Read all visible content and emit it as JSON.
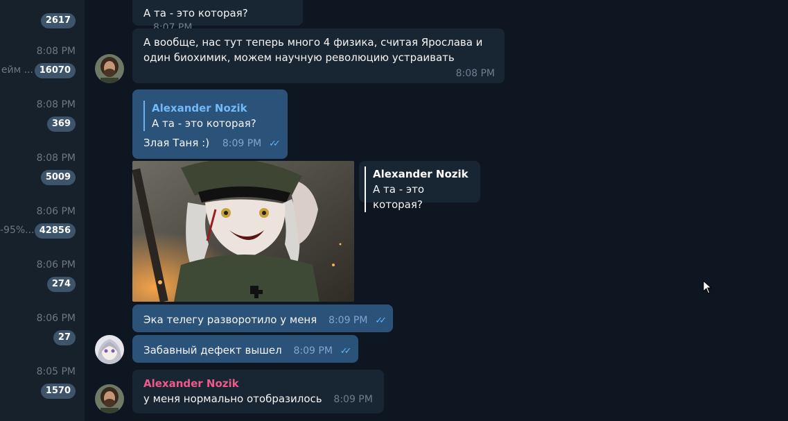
{
  "chat_list": [
    {
      "time": "",
      "preview": "",
      "badge": "2617"
    },
    {
      "time": "8:08 PM",
      "preview": "ейм ...",
      "badge": "16070"
    },
    {
      "time": "8:08 PM",
      "preview": "",
      "badge": "369"
    },
    {
      "time": "8:08 PM",
      "preview": "",
      "badge": "5009"
    },
    {
      "time": "8:06 PM",
      "preview": "-95%...",
      "badge": "42856"
    },
    {
      "time": "8:06 PM",
      "preview": "",
      "badge": "274"
    },
    {
      "time": "8:06 PM",
      "preview": "",
      "badge": "27"
    },
    {
      "time": "8:05 PM",
      "preview": "",
      "badge": "1570"
    }
  ],
  "messages": {
    "m1": {
      "text": "А та - это которая?",
      "time": "8:07 PM"
    },
    "m2": {
      "line1": "А вообще, нас тут теперь много 4 физика, считая Ярослава и",
      "line2": "один биохимик, можем научную революцию устраивать",
      "time": "8:08 PM"
    },
    "m3": {
      "reply_name": "Alexander Nozik",
      "reply_text": "А та - это которая?",
      "text": "Злая Таня :)",
      "time": "8:09 PM"
    },
    "m4": {
      "reply_name": "Alexander Nozik",
      "reply_text": "А та - это которая?"
    },
    "m5": {
      "text": "Эка телегу разворотило у меня",
      "time": "8:09 PM"
    },
    "m6": {
      "text": "Забавный дефект вышел",
      "time": "8:09 PM"
    },
    "m7": {
      "sender": "Alexander Nozik",
      "text": "у меня нормально отобразилось",
      "time": "8:09 PM"
    }
  },
  "colors": {
    "sender_pink": "#ee5a8a",
    "accent_blue": "#5eb5f7"
  }
}
